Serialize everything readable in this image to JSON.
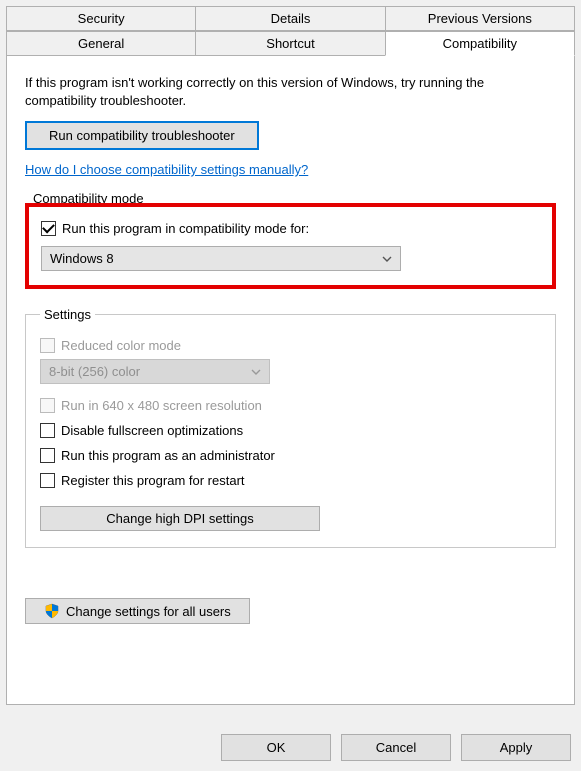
{
  "tabs": {
    "row1": [
      "Security",
      "Details",
      "Previous Versions"
    ],
    "row2": [
      "General",
      "Shortcut",
      "Compatibility"
    ],
    "active": "Compatibility"
  },
  "intro": "If this program isn't working correctly on this version of Windows, try running the compatibility troubleshooter.",
  "troubleshooter_button": "Run compatibility troubleshooter",
  "help_link": "How do I choose compatibility settings manually?",
  "compat_mode": {
    "legend": "Compatibility mode",
    "checkbox_label": "Run this program in compatibility mode for:",
    "checked": true,
    "selected_os": "Windows 8"
  },
  "settings": {
    "legend": "Settings",
    "reduced_color": {
      "label": "Reduced color mode",
      "checked": false,
      "enabled": false
    },
    "color_select": {
      "value": "8-bit (256) color",
      "enabled": false
    },
    "run_640": {
      "label": "Run in 640 x 480 screen resolution",
      "checked": false,
      "enabled": false
    },
    "disable_fullscreen": {
      "label": "Disable fullscreen optimizations",
      "checked": false,
      "enabled": true
    },
    "run_admin": {
      "label": "Run this program as an administrator",
      "checked": false,
      "enabled": true
    },
    "register_restart": {
      "label": "Register this program for restart",
      "checked": false,
      "enabled": true
    },
    "dpi_button": "Change high DPI settings"
  },
  "all_users_button": "Change settings for all users",
  "buttons": {
    "ok": "OK",
    "cancel": "Cancel",
    "apply": "Apply"
  }
}
